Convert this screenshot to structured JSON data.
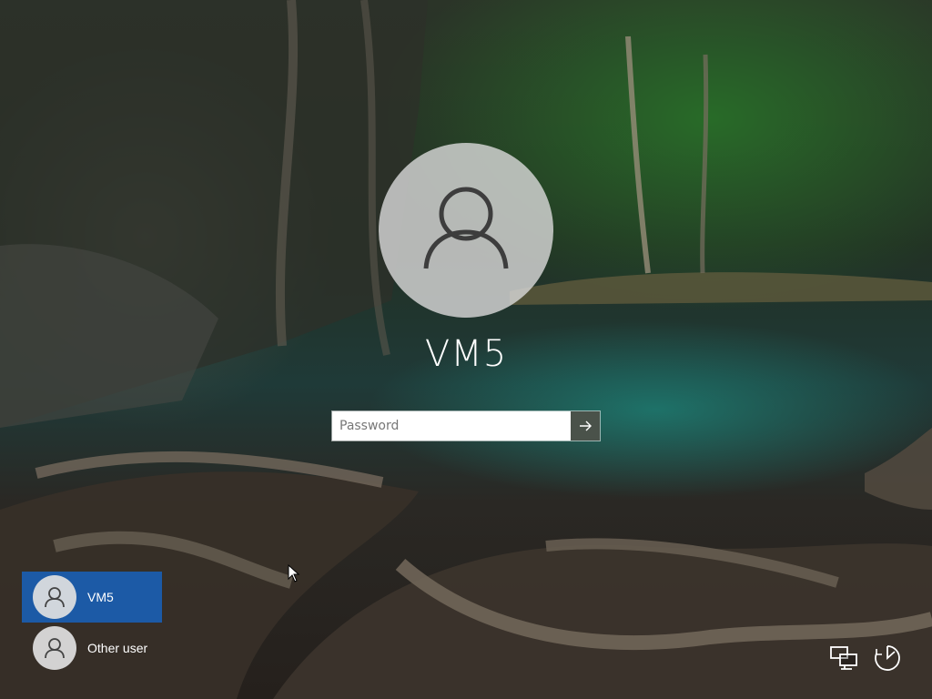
{
  "login": {
    "account_name": "VM5",
    "password_placeholder": "Password"
  },
  "users": [
    {
      "name": "VM5",
      "selected": true
    },
    {
      "name": "Other user",
      "selected": false
    }
  ],
  "icons": {
    "avatar": "user-silhouette-icon",
    "submit": "arrow-right-icon",
    "network": "network-icon",
    "ease_of_access": "ease-of-access-icon"
  },
  "colors": {
    "selected_user": "#1c5aa6",
    "submit_button": "#4a524a"
  }
}
